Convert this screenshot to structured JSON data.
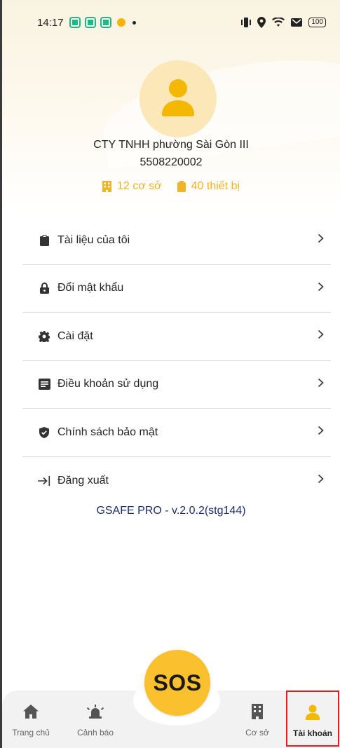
{
  "status_bar": {
    "time": "14:17",
    "battery": "100"
  },
  "profile": {
    "company_name": "CTY TNHH phường Sài Gòn III",
    "tax_code": "5508220002",
    "facilities_count": "12 cơ sở",
    "devices_count": "40 thiết bị",
    "accent_color": "#f0b429"
  },
  "menu": {
    "items": [
      {
        "label": "Tài liệu của tôi",
        "icon": "clipboard-icon"
      },
      {
        "label": "Đổi mật khẩu",
        "icon": "lock-icon"
      },
      {
        "label": "Cài đặt",
        "icon": "gear-icon"
      },
      {
        "label": "Điều khoản sử dụng",
        "icon": "document-icon"
      },
      {
        "label": "Chính sách bảo mật",
        "icon": "shield-icon"
      },
      {
        "label": "Đăng xuất",
        "icon": "logout-icon"
      }
    ]
  },
  "version": "GSAFE PRO - v.2.0.2(stg144)",
  "bottom_nav": {
    "home_label": "Trang chủ",
    "alert_label": "Cảnh báo",
    "sos_label": "SOS",
    "facility_label": "Cơ sở",
    "account_label": "Tài khoản",
    "active": "Tài khoản"
  }
}
